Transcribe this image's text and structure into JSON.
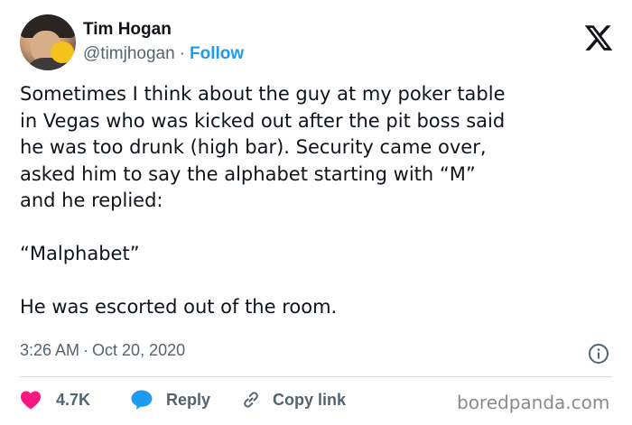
{
  "author": {
    "name": "Tim Hogan",
    "handle": "@timjhogan",
    "separator": "·",
    "follow_label": "Follow"
  },
  "tweet": {
    "text": "Sometimes I think about the guy at my poker table\nin Vegas who was kicked out after the pit boss said\nhe was too drunk (high bar). Security came over,\nasked him to say the alphabet starting with “M”\nand he replied:\n\n“Malphabet”\n\nHe was escorted out of the room.",
    "time": "3:26 AM",
    "separator": "·",
    "date": "Oct 20, 2020"
  },
  "actions": {
    "like_count": "4.7K",
    "reply_label": "Reply",
    "copy_link_label": "Copy link"
  },
  "watermark": "boredpanda.com",
  "colors": {
    "text": "#0f1419",
    "secondary": "#536471",
    "link": "#1d9bf0",
    "like": "#f91880",
    "divider": "#cfd9de"
  },
  "icons": [
    "x-logo-icon",
    "info-icon",
    "heart-icon",
    "reply-bubble-icon",
    "link-icon"
  ]
}
